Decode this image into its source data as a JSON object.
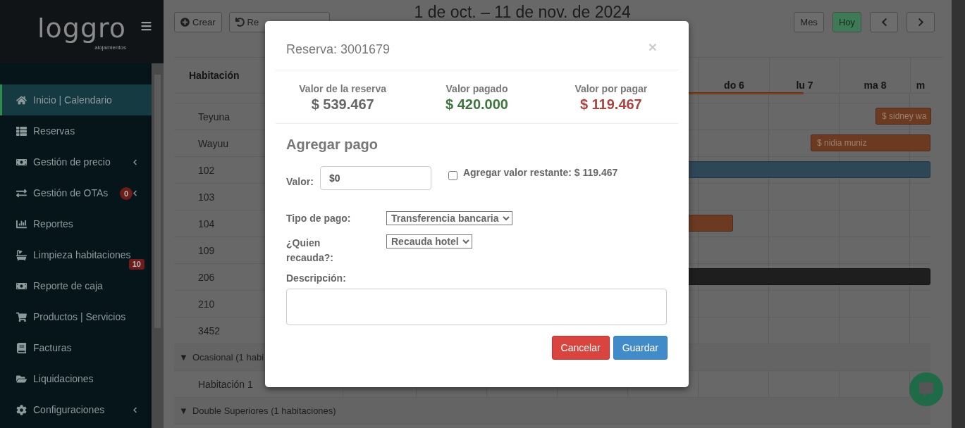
{
  "sidebar": {
    "logo": {
      "word": "loggro",
      "tagline": "alojamientos"
    },
    "items": [
      {
        "label": "Inicio | Calendario",
        "selected": true,
        "expandable": false
      },
      {
        "label": "Reservas",
        "selected": false,
        "expandable": false
      },
      {
        "label": "Gestión de precio",
        "selected": false,
        "expandable": true
      },
      {
        "label": "Gestión de OTAs",
        "selected": false,
        "expandable": true,
        "badge": "0"
      },
      {
        "label": "Reportes",
        "selected": false,
        "expandable": false
      },
      {
        "label": "Limpieza habitaciones",
        "selected": false,
        "expandable": false,
        "badge": "10"
      },
      {
        "label": "Reporte de caja",
        "selected": false,
        "expandable": false
      },
      {
        "label": "Productos | Servicios",
        "selected": false,
        "expandable": false
      },
      {
        "label": "Facturas",
        "selected": false,
        "expandable": false
      },
      {
        "label": "Liquidaciones",
        "selected": false,
        "expandable": false
      },
      {
        "label": "Configuraciones",
        "selected": false,
        "expandable": true
      }
    ]
  },
  "toolbar": {
    "buttons": [
      {
        "label": "Crear"
      },
      {
        "label": "Re"
      }
    ],
    "title": "1 de oct. – 11 de nov. de 2024",
    "view_buttons": [
      {
        "label": "Mes",
        "kind": "default"
      },
      {
        "label": "Hoy",
        "kind": "success"
      }
    ]
  },
  "calendar": {
    "room_header": "Habitación",
    "days": [
      "do 6",
      "lu 7",
      "ma 8",
      "m"
    ],
    "rows": [
      {
        "kind": "partial",
        "event": {
          "color": "#8a4420"
        }
      },
      {
        "kind": "room",
        "name": "Teyuna",
        "event": {
          "label": "$ sidney wa",
          "color": "#6b3a20"
        }
      },
      {
        "kind": "room",
        "name": "Wayuu",
        "event": {
          "label": "$ nidia muniz",
          "color": "#6b3a20"
        }
      },
      {
        "kind": "room",
        "name": "102",
        "event": {
          "color": "#2e4757"
        }
      },
      {
        "kind": "room",
        "name": "103"
      },
      {
        "kind": "room",
        "name": "104",
        "event": {
          "color": "#6b3a20"
        }
      },
      {
        "kind": "room",
        "name": "109"
      },
      {
        "kind": "room",
        "name": "206",
        "event": {
          "color": "#1e1e1e"
        }
      },
      {
        "kind": "room",
        "name": "210"
      },
      {
        "kind": "room",
        "name": "3452"
      },
      {
        "kind": "group",
        "marker": "▼",
        "name": "Ocasional (1 habi"
      },
      {
        "kind": "room",
        "name": "Habitación 1"
      },
      {
        "kind": "group",
        "marker": "▼",
        "name": "Double Superiores (1 habitaciones)"
      }
    ]
  },
  "modal": {
    "title": "Reserva: 3001679",
    "close": "×",
    "summary": [
      {
        "label": "Valor de la reserva",
        "value": "$ 539.467",
        "color": "#666666"
      },
      {
        "label": "Valor pagado",
        "value": "$ 420.000",
        "color": "#3c763d"
      },
      {
        "label": "Valor por pagar",
        "value": "$ 119.467",
        "color": "#a94442"
      }
    ],
    "section_title": "Agregar pago",
    "amount": {
      "label": "Valor:",
      "value": "$0"
    },
    "remaining": {
      "label": "Agregar valor restante: $ 119.467",
      "checked": false
    },
    "payment_type": {
      "label": "Tipo de pago:",
      "value": "Transferencia bancaria"
    },
    "collector": {
      "label": "¿Quien recauda?:",
      "value": "Recauda hotel"
    },
    "description": {
      "label": "Descripción:"
    },
    "buttons": [
      {
        "label": "Cancelar",
        "kind": "danger"
      },
      {
        "label": "Guardar",
        "kind": "primary"
      }
    ]
  }
}
